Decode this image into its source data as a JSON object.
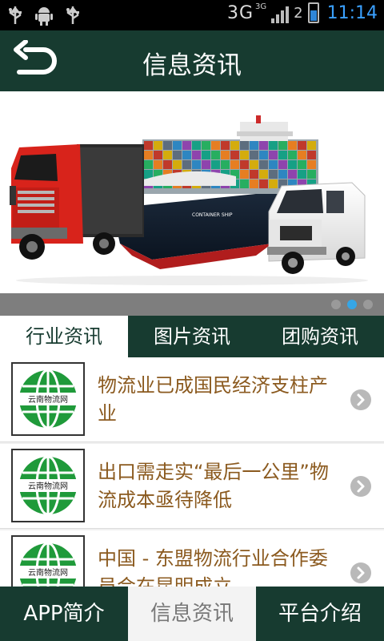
{
  "status_bar": {
    "network": "3G",
    "network_small": "3G",
    "sim": "2",
    "time": "11:14",
    "icons": [
      "usb-icon",
      "android-debug-icon",
      "usb-icon",
      "signal-icon",
      "battery-charging-icon"
    ]
  },
  "header": {
    "title": "信息资讯",
    "back_icon": "back-arrow-icon"
  },
  "banner": {
    "ship_caption": "CONTAINER SHIP",
    "pager": {
      "count": 3,
      "active_index": 1
    }
  },
  "tabs": [
    {
      "label": "行业资讯",
      "active": true
    },
    {
      "label": "图片资讯",
      "active": false
    },
    {
      "label": "团购资讯",
      "active": false
    }
  ],
  "news": [
    {
      "title": "物流业已成国民经济支柱产业",
      "thumb_label": "云南物流网"
    },
    {
      "title": "出口需走实“最后一公里”物流成本亟待降低",
      "thumb_label": "云南物流网"
    },
    {
      "title": "中国 - 东盟物流行业合作委员会在昆明成立",
      "thumb_label": "云南物流网"
    }
  ],
  "bottom_nav": [
    {
      "label": "APP简介",
      "active": false
    },
    {
      "label": "信息资讯",
      "active": true
    },
    {
      "label": "平台介绍",
      "active": false
    }
  ],
  "colors": {
    "brand_dark": "#173b30",
    "news_text": "#8b5a1f",
    "globe_green": "#1f9a3a",
    "pager_active": "#35a6e6"
  }
}
